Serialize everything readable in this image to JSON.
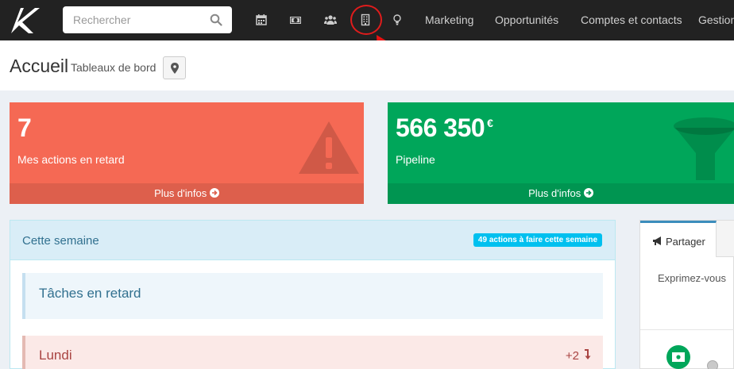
{
  "topbar": {
    "search_placeholder": "Rechercher",
    "nav_icons": [
      "calendar-icon",
      "money-icon",
      "users-icon",
      "building-icon",
      "lightbulb-icon"
    ],
    "nav_links": [
      "Marketing",
      "Opportunités",
      "Comptes et contacts",
      "Gestion"
    ]
  },
  "header": {
    "title": "Accueil",
    "subtitle": "Tableaux de bord"
  },
  "boxes": {
    "late": {
      "value": "7",
      "label": "Mes actions en retard",
      "footer": "Plus d'infos",
      "color": "#f56954"
    },
    "pipeline": {
      "value": "566 350",
      "currency": "€",
      "label": "Pipeline",
      "footer": "Plus d'infos",
      "color": "#00a65a"
    }
  },
  "week": {
    "title": "Cette semaine",
    "badge": "49 actions à faire cette semaine",
    "late_tasks": "Tâches en retard",
    "day": {
      "name": "Lundi",
      "count": "+2"
    }
  },
  "share": {
    "tab": "Partager",
    "placeholder": "Exprimez-vous"
  },
  "colors": {
    "accent": "#3c8dbc",
    "topbar": "#222222",
    "annotation": "#e01c1c"
  }
}
